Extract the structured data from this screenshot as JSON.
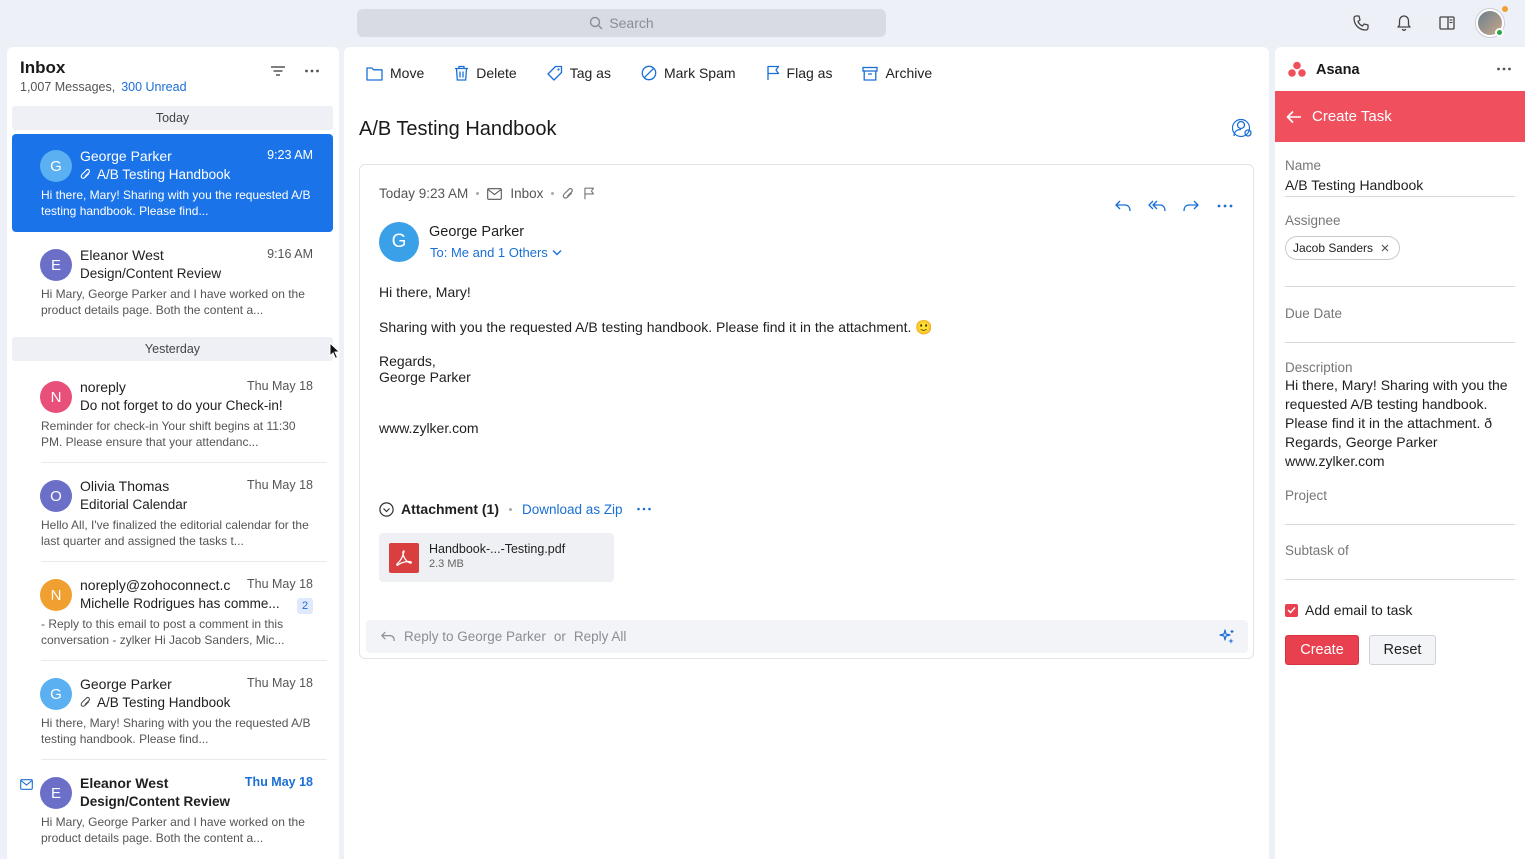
{
  "search": {
    "placeholder": "Search"
  },
  "topbar": {
    "icons": [
      "phone-icon",
      "bell-icon",
      "reading-pane-icon",
      "user-avatar"
    ]
  },
  "inbox": {
    "title": "Inbox",
    "messages_count": "1,007 Messages,",
    "unread": "300 Unread",
    "groups": [
      {
        "label": "Today"
      },
      {
        "label": "Yesterday"
      }
    ],
    "mails": [
      {
        "initial": "G",
        "from": "George Parker",
        "time": "9:23 AM",
        "subject": "A/B Testing Handbook",
        "preview": "Hi there, Mary! Sharing with you the requested A/B testing handbook. Please find...",
        "color": "#3aa0e8",
        "attachment": true,
        "selected": true
      },
      {
        "initial": "E",
        "from": "Eleanor West",
        "time": "9:16 AM",
        "subject": "Design/Content Review",
        "preview": "Hi Mary, George Parker and I have worked on the product details page. Both the content a...",
        "color": "#6b6fc7"
      },
      {
        "initial": "N",
        "from": "noreply",
        "time": "Thu May 18",
        "subject": "Do not forget to do your Check-in!",
        "preview": "Reminder for check-in Your shift begins at 11:30 PM. Please ensure that your attendanc...",
        "color": "#e8507a"
      },
      {
        "initial": "O",
        "from": "Olivia Thomas",
        "time": "Thu May 18",
        "subject": "Editorial Calendar",
        "preview": "Hello All, I've finalized the editorial calendar for the last quarter and assigned the tasks t...",
        "color": "#6b6fc7"
      },
      {
        "initial": "N",
        "from": "noreply@zohoconnect.c",
        "time": "Thu May 18",
        "subject": "Michelle Rodrigues has comme...",
        "preview": "- Reply to this email to post a comment in this conversation - zylker Hi Jacob Sanders, Mic...",
        "color": "#f0a030",
        "badge": "2"
      },
      {
        "initial": "G",
        "from": "George Parker",
        "time": "Thu May 18",
        "subject": "A/B Testing Handbook",
        "preview": "Hi there, Mary! Sharing with you the requested A/B testing handbook. Please find...",
        "color": "#3aa0e8",
        "attachment": true
      },
      {
        "initial": "E",
        "from": "Eleanor West",
        "time": "Thu May 18",
        "subject": "Design/Content Review",
        "preview": "Hi Mary, George Parker and I have worked on the product details page. Both the content a...",
        "color": "#6b6fc7",
        "unread": true
      }
    ]
  },
  "toolbar": {
    "move": "Move",
    "delete": "Delete",
    "tag": "Tag as",
    "spam": "Mark Spam",
    "flag": "Flag as",
    "archive": "Archive"
  },
  "message": {
    "title": "A/B Testing Handbook",
    "date": "Today 9:23 AM",
    "folder": "Inbox",
    "sender_initial": "G",
    "sender_name": "George Parker",
    "to": "To: Me and 1 Others",
    "body": {
      "greeting": "Hi there, Mary!",
      "line1": "Sharing with you the requested A/B testing handbook. Please find it in the attachment. 🙂",
      "regards": "Regards,",
      "signature": "George Parker",
      "website": "www.zylker.com"
    },
    "attachment_label": "Attachment (1)",
    "download_zip": "Download as Zip",
    "file_name": "Handbook-...-Testing.pdf",
    "file_size": "2.3 MB",
    "reply_to": "Reply to George Parker",
    "reply_or": "or",
    "reply_all": "Reply All"
  },
  "asana": {
    "app_name": "Asana",
    "header": "Create Task",
    "name_label": "Name",
    "name_value": "A/B Testing Handbook",
    "assignee_label": "Assignee",
    "assignee_value": "Jacob Sanders",
    "due_label": "Due Date",
    "desc_label": "Description",
    "desc_value": "Hi there, Mary! Sharing with you the requested A/B testing handbook. Please find it in the attachment. ð Regards, George Parker www.zylker.com",
    "project_label": "Project",
    "subtask_label": "Subtask of",
    "add_email_label": "Add email to task",
    "add_email_checked": true,
    "create_btn": "Create",
    "reset_btn": "Reset",
    "accent": "#f0505e"
  }
}
